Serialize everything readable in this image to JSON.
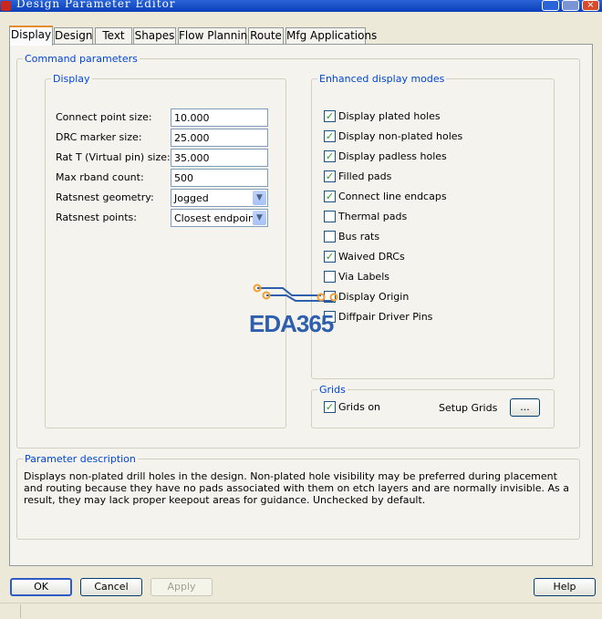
{
  "window": {
    "title": "Design Parameter Editor"
  },
  "tabs": [
    {
      "label": "Display",
      "active": true
    },
    {
      "label": "Design"
    },
    {
      "label": "Text"
    },
    {
      "label": "Shapes"
    },
    {
      "label": "Flow Planning"
    },
    {
      "label": "Route"
    },
    {
      "label": "Mfg Applications"
    }
  ],
  "command_parameters": {
    "title": "Command parameters",
    "display": {
      "title": "Display",
      "fields": [
        {
          "label": "Connect point size:",
          "value": "10.000"
        },
        {
          "label": "DRC marker size:",
          "value": "25.000"
        },
        {
          "label": "Rat T (Virtual pin) size:",
          "value": "35.000"
        },
        {
          "label": "Max rband count:",
          "value": "500"
        },
        {
          "label": "Ratsnest geometry:",
          "value": "Jogged"
        },
        {
          "label": "Ratsnest points:",
          "value": "Closest endpoint"
        }
      ]
    },
    "enhanced": {
      "title": "Enhanced display modes",
      "items": [
        {
          "label": "Display plated holes",
          "checked": true
        },
        {
          "label": "Display non-plated holes",
          "checked": true
        },
        {
          "label": "Display padless holes",
          "checked": true
        },
        {
          "label": "Filled pads",
          "checked": true
        },
        {
          "label": "Connect line endcaps",
          "checked": true
        },
        {
          "label": "Thermal pads",
          "checked": false
        },
        {
          "label": "Bus rats",
          "checked": false
        },
        {
          "label": "Waived DRCs",
          "checked": true
        },
        {
          "label": "Via Labels",
          "checked": false
        },
        {
          "label": "Display Origin",
          "checked": false
        },
        {
          "label": "Diffpair Driver Pins",
          "checked": false
        }
      ]
    },
    "grids": {
      "title": "Grids",
      "grids_on_label": "Grids on",
      "grids_on_checked": true,
      "setup_label": "Setup Grids",
      "setup_button": "..."
    }
  },
  "parameter_description": {
    "title": "Parameter description",
    "text": "Displays non-plated drill holes in the design. Non-plated hole visibility may be preferred during placement and routing because they have no pads associated with them on etch layers and are normally invisible. As a result, they may lack proper keepout areas for guidance. Unchecked by default."
  },
  "buttons": {
    "ok": "OK",
    "cancel": "Cancel",
    "apply": "Apply",
    "help": "Help"
  },
  "watermark": {
    "text": "EDA365",
    "color": "#2e5fae",
    "accent": "#f0a030"
  },
  "colors": {
    "legend": "#0046d5",
    "tab_highlight": "#e68b2c",
    "check": "#21a121"
  }
}
